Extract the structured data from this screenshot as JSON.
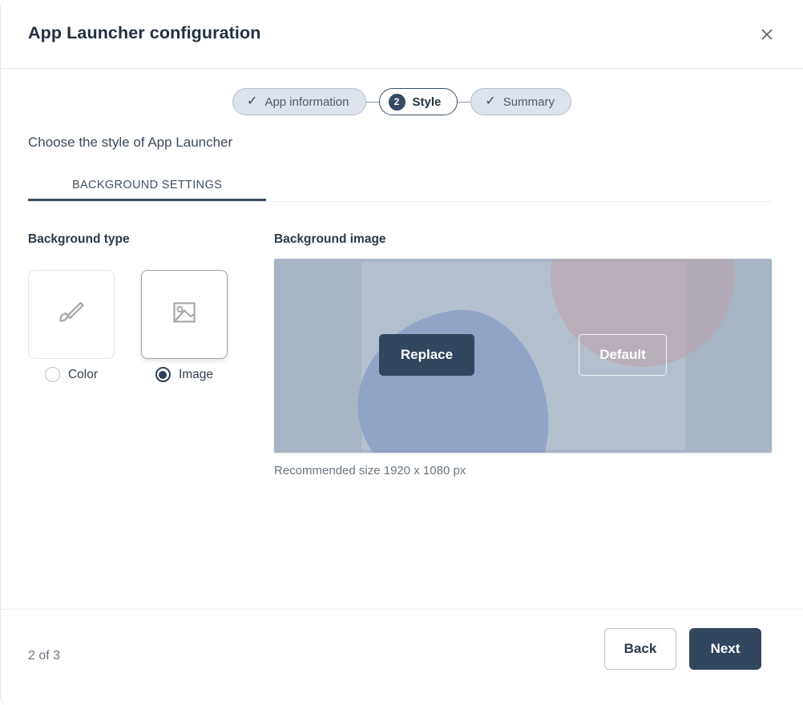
{
  "window": {
    "title": "App Launcher configuration",
    "close_icon": "close-icon"
  },
  "stepper": {
    "steps": [
      {
        "label": "App information",
        "state": "done",
        "marker": "✓"
      },
      {
        "label": "Style",
        "state": "active",
        "marker": "2"
      },
      {
        "label": "Summary",
        "state": "done",
        "marker": "✓"
      }
    ]
  },
  "content": {
    "subtitle": "Choose the style of App Launcher",
    "tabs": [
      {
        "label": "BACKGROUND SETTINGS",
        "active": true
      }
    ],
    "background_type": {
      "label": "Background type",
      "options": [
        {
          "label": "Color",
          "icon": "paintbrush-icon",
          "selected": false
        },
        {
          "label": "Image",
          "icon": "picture-icon",
          "selected": true
        }
      ]
    },
    "background_image": {
      "label": "Background image",
      "replace_label": "Replace",
      "default_label": "Default",
      "hint": "Recommended size 1920 x 1080 px"
    }
  },
  "footer": {
    "page_count": "2 of 3",
    "back_label": "Back",
    "next_label": "Next"
  },
  "colors": {
    "primary": "#32475d",
    "step_done_bg": "#dde3ec",
    "step_done_border": "#b2bdcd",
    "tab_underline": "#3a4d63",
    "preview_bg": "#a7b4c4",
    "preview_blob": "#8b9fc4",
    "preview_circle": "#b9a3ad",
    "title_text": "#22303f"
  }
}
